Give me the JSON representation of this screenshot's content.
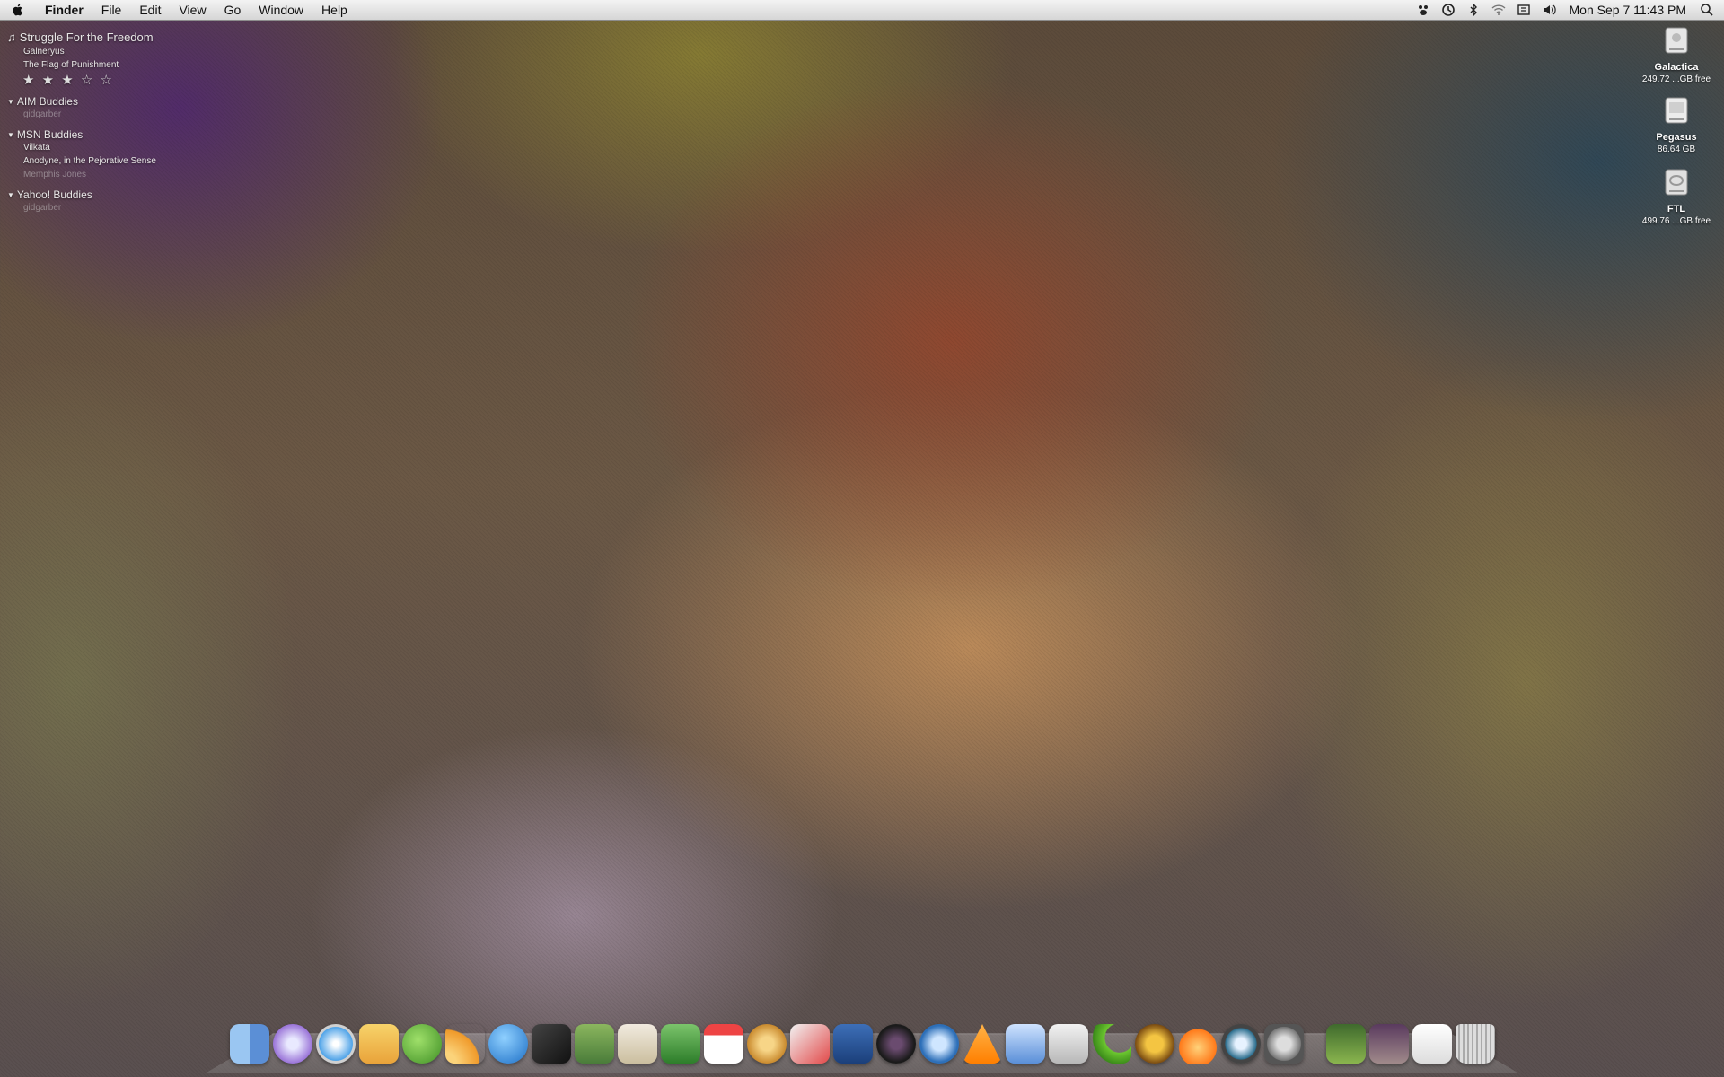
{
  "menubar": {
    "app": "Finder",
    "items": [
      "File",
      "Edit",
      "View",
      "Go",
      "Window",
      "Help"
    ],
    "clock": "Mon Sep 7  11:43 PM"
  },
  "now_playing": {
    "title": "Struggle For the Freedom",
    "artist": "Galneryus",
    "album": "The Flag of Punishment",
    "rating_text": "★ ★ ★ ☆ ☆"
  },
  "buddy_groups": [
    {
      "title": "AIM Buddies",
      "buddies": [
        "gidgarber"
      ]
    },
    {
      "title": "MSN Buddies",
      "buddies": [
        "Vilkata",
        "Anodyne, in the Pejorative Sense",
        "Memphis Jones"
      ]
    },
    {
      "title": "Yahoo! Buddies",
      "buddies": [
        "gidgarber"
      ]
    }
  ],
  "desktop_icons": [
    {
      "name": "Galactica",
      "free": "249.72 ...GB free"
    },
    {
      "name": "Pegasus",
      "free": "86.64 GB"
    },
    {
      "name": "FTL",
      "free": "499.76 ...GB free"
    }
  ],
  "colors": {
    "menubar": "#e2e2e2",
    "widget_text": "#e8e6e6"
  }
}
